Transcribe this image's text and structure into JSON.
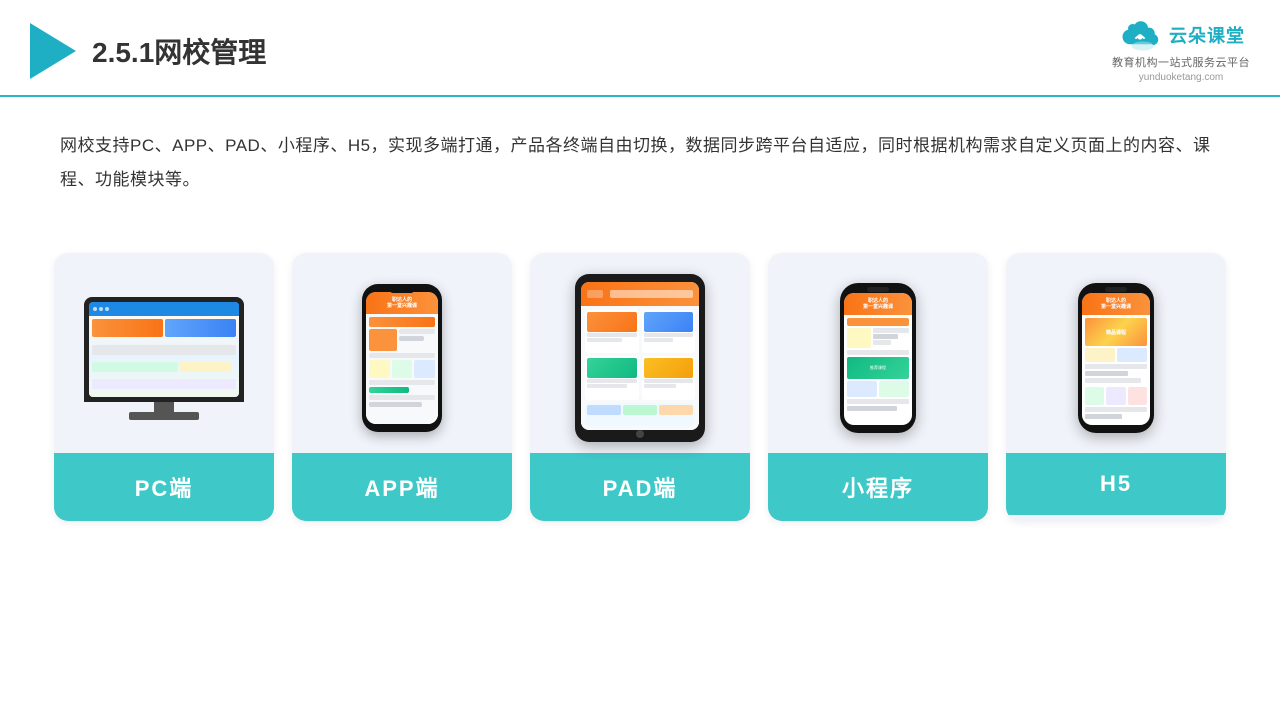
{
  "header": {
    "title": "2.5.1网校管理",
    "logo_text": "云朵课堂",
    "logo_url": "yunduoketang.com",
    "logo_subtitle": "教育机构一站\n式服务云平台"
  },
  "description": {
    "text": "网校支持PC、APP、PAD、小程序、H5，实现多端打通，产品各终端自由切换，数据同步跨平台自适应，同时根据机构需求自定义页面上的内容、课程、功能模块等。"
  },
  "cards": [
    {
      "label": "PC端",
      "type": "pc"
    },
    {
      "label": "APP端",
      "type": "phone"
    },
    {
      "label": "PAD端",
      "type": "tablet"
    },
    {
      "label": "小程序",
      "type": "mini_phone"
    },
    {
      "label": "H5",
      "type": "mini_phone2"
    }
  ]
}
